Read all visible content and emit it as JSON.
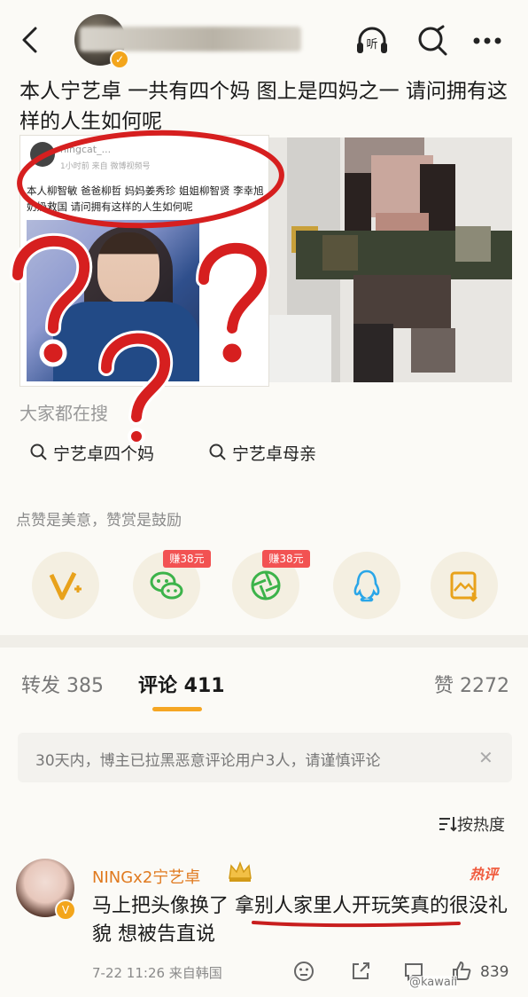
{
  "header": {
    "listen_label": "听"
  },
  "post": {
    "text": "本人宁艺卓 一共有四个妈 图上是四妈之一 请问拥有这样的人生如何呢",
    "mini": {
      "name": "ningcat_...",
      "sub": "1小时前  来自 微博视频号",
      "text": "本人柳智敏 爸爸柳哲 妈妈姜秀珍 姐姐柳智贤 李幸旭 奶奶救国 请问拥有这样的人生如何呢"
    }
  },
  "trending": {
    "title": "大家都在搜",
    "items": [
      "宁艺卓四个妈",
      "宁艺卓母亲"
    ]
  },
  "thanks_text": "点赞是美意，赞赏是鼓励",
  "share": {
    "earn1": "赚38元",
    "earn2": "赚38元"
  },
  "tabs": {
    "repost": "转发 385",
    "comment": "评论 411",
    "like": "赞 2272"
  },
  "notice": {
    "text": "30天内，博主已拉黑恶意评论用户3人，请谨慎评论",
    "close": "✕"
  },
  "sort_label": "按热度",
  "comment": {
    "name": "NINGx2宁艺卓",
    "hot_badge": "热评",
    "text": "马上把头像换了 拿别人家里人开玩笑真的很没礼貌 想被告直说",
    "meta": "7-22 11:26  来自韩国",
    "likes": "839"
  },
  "watermark": "@kawaii"
}
